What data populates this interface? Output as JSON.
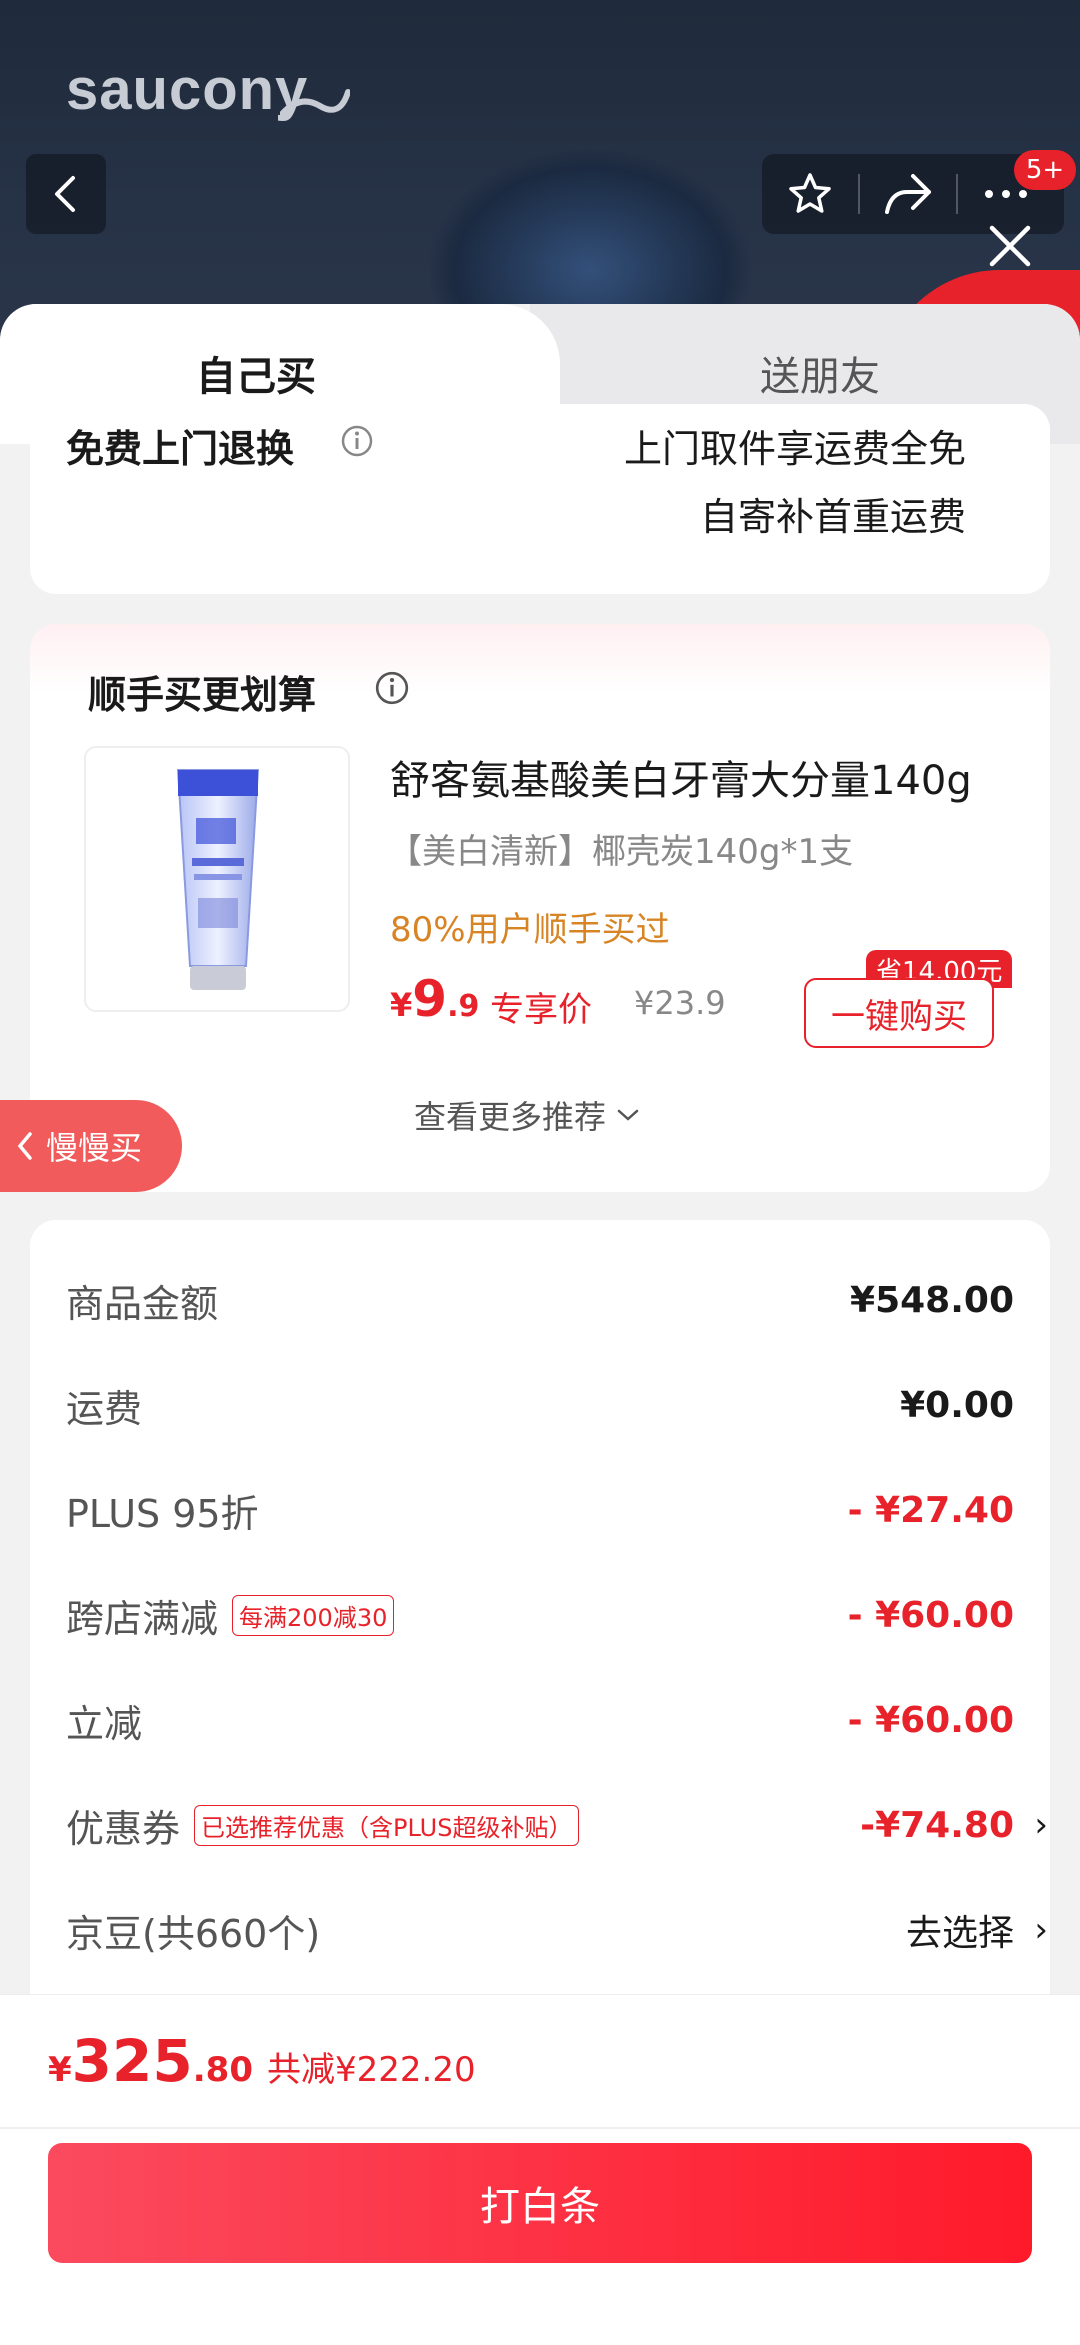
{
  "header": {
    "brand": "saucony",
    "badge": "5+"
  },
  "tabs": {
    "self": "自己买",
    "gift": "送朋友"
  },
  "return_card": {
    "title": "免费上门退换",
    "right_line1": "上门取件享运费全免",
    "right_line2": "自寄补首重运费"
  },
  "recommend": {
    "title": "顺手买更划算",
    "product_name": "舒客氨基酸美白牙膏大分量140g",
    "spec": "【美白清新】椰壳炭140g*1支",
    "social_proof": "80%用户顺手买过",
    "price_currency": "¥",
    "price_int": "9",
    "price_dec": ".9",
    "price_tag": "专享价",
    "original_price": "¥23.9",
    "save_tag": "省14.00元",
    "buy_button": "一键购买",
    "more": "查看更多推荐",
    "slow_buy": "慢慢买"
  },
  "summary": {
    "rows": [
      {
        "label": "商品金额",
        "value": "¥548.00"
      },
      {
        "label": "运费",
        "value": "¥0.00"
      },
      {
        "label": "PLUS 95折",
        "value": "- ¥27.40"
      },
      {
        "label": "跨店满减",
        "tag": "每满200减30",
        "value": "- ¥60.00"
      },
      {
        "label": "立减",
        "value": "- ¥60.00"
      },
      {
        "label": "优惠券",
        "tag": "已选推荐优惠（含PLUS超级补贴）",
        "value": "-¥74.80"
      },
      {
        "label": "京豆(共660个)",
        "value": "去选择"
      }
    ]
  },
  "footer": {
    "currency": "¥",
    "total_int": "325",
    "total_dec": ".80",
    "discount": "共减¥222.20",
    "pay_button": "打白条"
  },
  "colors": {
    "accent": "#e8222a",
    "social": "#d78424",
    "header_bg": "#1f2a3b"
  }
}
